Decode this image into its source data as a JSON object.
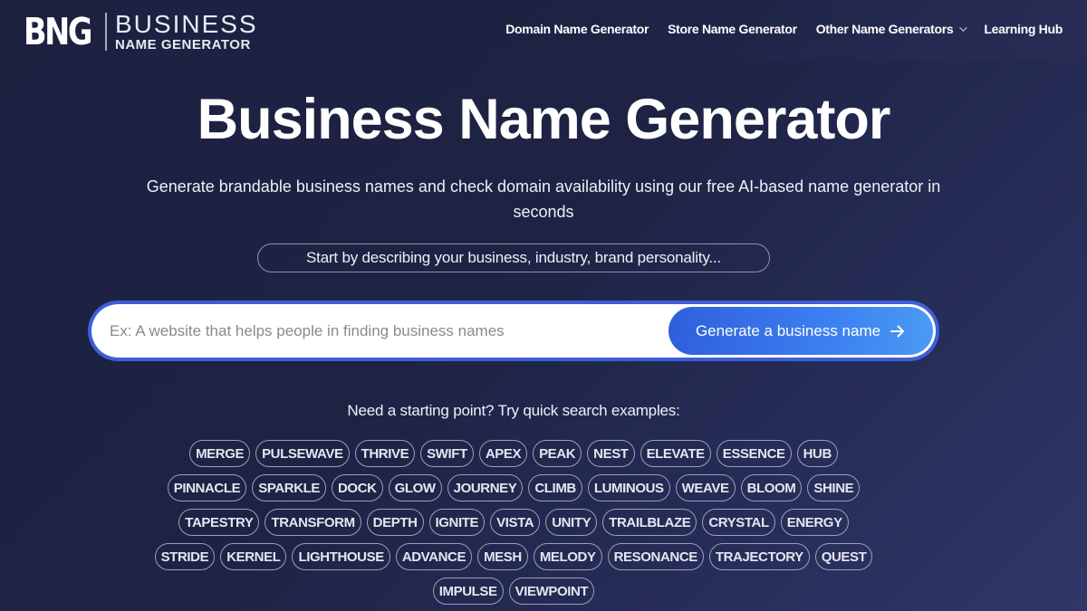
{
  "brand": {
    "mark": "BNG",
    "name_top": "BUSINESS",
    "name_bottom": "NAME GENERATOR"
  },
  "nav": {
    "items": [
      {
        "label": "Domain Name Generator",
        "icon": null
      },
      {
        "label": "Store Name Generator",
        "icon": null
      },
      {
        "label": "Other Name Generators",
        "icon": "chevron-down-icon"
      },
      {
        "label": "Learning Hub",
        "icon": null
      }
    ]
  },
  "hero": {
    "title": "Business Name Generator",
    "subtitle": "Generate brandable business names and check domain availability using our free AI-based name generator in seconds",
    "prompt_hint": "Start by describing your business, industry, brand personality..."
  },
  "search": {
    "value": "",
    "placeholder": "Ex: A website that helps people in finding business names",
    "button_label": "Generate a business name",
    "button_icon": "arrow-right-icon"
  },
  "examples": {
    "label": "Need a starting point? Try quick search examples:",
    "tags": [
      "MERGE",
      "PULSEWAVE",
      "THRIVE",
      "SWIFT",
      "APEX",
      "PEAK",
      "NEST",
      "ELEVATE",
      "ESSENCE",
      "HUB",
      "PINNACLE",
      "SPARKLE",
      "DOCK",
      "GLOW",
      "JOURNEY",
      "CLIMB",
      "LUMINOUS",
      "WEAVE",
      "BLOOM",
      "SHINE",
      "TAPESTRY",
      "TRANSFORM",
      "DEPTH",
      "IGNITE",
      "VISTA",
      "UNITY",
      "TRAILBLAZE",
      "CRYSTAL",
      "ENERGY",
      "STRIDE",
      "KERNEL",
      "LIGHTHOUSE",
      "ADVANCE",
      "MESH",
      "MELODY",
      "RESONANCE",
      "TRAJECTORY",
      "QUEST",
      "IMPULSE",
      "VIEWPOINT"
    ]
  },
  "colors": {
    "background": "#1e2344",
    "accent": "#3d5fd8",
    "button_gradient_start": "#2f5fdc",
    "button_gradient_end": "#4a9af5"
  }
}
